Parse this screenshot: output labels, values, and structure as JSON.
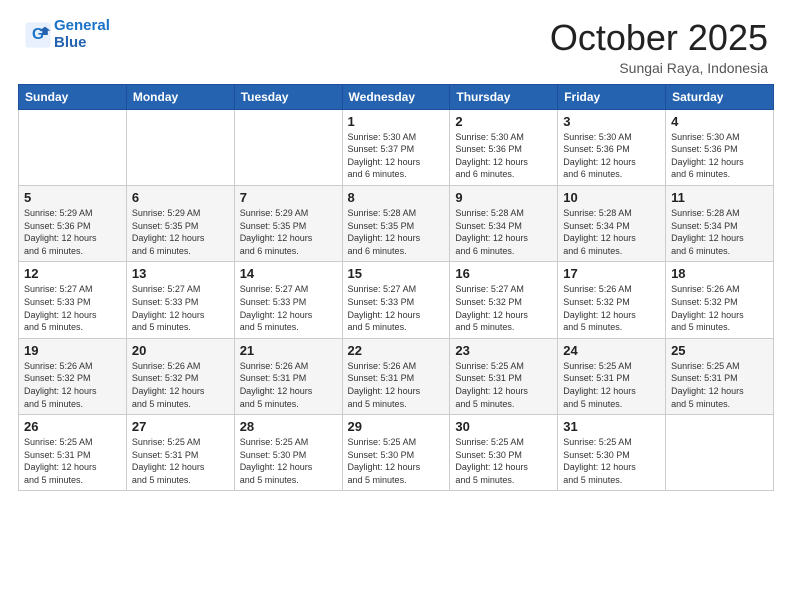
{
  "header": {
    "logo_line1": "General",
    "logo_line2": "Blue",
    "month": "October 2025",
    "location": "Sungai Raya, Indonesia"
  },
  "days_of_week": [
    "Sunday",
    "Monday",
    "Tuesday",
    "Wednesday",
    "Thursday",
    "Friday",
    "Saturday"
  ],
  "weeks": [
    [
      {
        "day": "",
        "detail": ""
      },
      {
        "day": "",
        "detail": ""
      },
      {
        "day": "",
        "detail": ""
      },
      {
        "day": "1",
        "detail": "Sunrise: 5:30 AM\nSunset: 5:37 PM\nDaylight: 12 hours\nand 6 minutes."
      },
      {
        "day": "2",
        "detail": "Sunrise: 5:30 AM\nSunset: 5:36 PM\nDaylight: 12 hours\nand 6 minutes."
      },
      {
        "day": "3",
        "detail": "Sunrise: 5:30 AM\nSunset: 5:36 PM\nDaylight: 12 hours\nand 6 minutes."
      },
      {
        "day": "4",
        "detail": "Sunrise: 5:30 AM\nSunset: 5:36 PM\nDaylight: 12 hours\nand 6 minutes."
      }
    ],
    [
      {
        "day": "5",
        "detail": "Sunrise: 5:29 AM\nSunset: 5:36 PM\nDaylight: 12 hours\nand 6 minutes."
      },
      {
        "day": "6",
        "detail": "Sunrise: 5:29 AM\nSunset: 5:35 PM\nDaylight: 12 hours\nand 6 minutes."
      },
      {
        "day": "7",
        "detail": "Sunrise: 5:29 AM\nSunset: 5:35 PM\nDaylight: 12 hours\nand 6 minutes."
      },
      {
        "day": "8",
        "detail": "Sunrise: 5:28 AM\nSunset: 5:35 PM\nDaylight: 12 hours\nand 6 minutes."
      },
      {
        "day": "9",
        "detail": "Sunrise: 5:28 AM\nSunset: 5:34 PM\nDaylight: 12 hours\nand 6 minutes."
      },
      {
        "day": "10",
        "detail": "Sunrise: 5:28 AM\nSunset: 5:34 PM\nDaylight: 12 hours\nand 6 minutes."
      },
      {
        "day": "11",
        "detail": "Sunrise: 5:28 AM\nSunset: 5:34 PM\nDaylight: 12 hours\nand 6 minutes."
      }
    ],
    [
      {
        "day": "12",
        "detail": "Sunrise: 5:27 AM\nSunset: 5:33 PM\nDaylight: 12 hours\nand 5 minutes."
      },
      {
        "day": "13",
        "detail": "Sunrise: 5:27 AM\nSunset: 5:33 PM\nDaylight: 12 hours\nand 5 minutes."
      },
      {
        "day": "14",
        "detail": "Sunrise: 5:27 AM\nSunset: 5:33 PM\nDaylight: 12 hours\nand 5 minutes."
      },
      {
        "day": "15",
        "detail": "Sunrise: 5:27 AM\nSunset: 5:33 PM\nDaylight: 12 hours\nand 5 minutes."
      },
      {
        "day": "16",
        "detail": "Sunrise: 5:27 AM\nSunset: 5:32 PM\nDaylight: 12 hours\nand 5 minutes."
      },
      {
        "day": "17",
        "detail": "Sunrise: 5:26 AM\nSunset: 5:32 PM\nDaylight: 12 hours\nand 5 minutes."
      },
      {
        "day": "18",
        "detail": "Sunrise: 5:26 AM\nSunset: 5:32 PM\nDaylight: 12 hours\nand 5 minutes."
      }
    ],
    [
      {
        "day": "19",
        "detail": "Sunrise: 5:26 AM\nSunset: 5:32 PM\nDaylight: 12 hours\nand 5 minutes."
      },
      {
        "day": "20",
        "detail": "Sunrise: 5:26 AM\nSunset: 5:32 PM\nDaylight: 12 hours\nand 5 minutes."
      },
      {
        "day": "21",
        "detail": "Sunrise: 5:26 AM\nSunset: 5:31 PM\nDaylight: 12 hours\nand 5 minutes."
      },
      {
        "day": "22",
        "detail": "Sunrise: 5:26 AM\nSunset: 5:31 PM\nDaylight: 12 hours\nand 5 minutes."
      },
      {
        "day": "23",
        "detail": "Sunrise: 5:25 AM\nSunset: 5:31 PM\nDaylight: 12 hours\nand 5 minutes."
      },
      {
        "day": "24",
        "detail": "Sunrise: 5:25 AM\nSunset: 5:31 PM\nDaylight: 12 hours\nand 5 minutes."
      },
      {
        "day": "25",
        "detail": "Sunrise: 5:25 AM\nSunset: 5:31 PM\nDaylight: 12 hours\nand 5 minutes."
      }
    ],
    [
      {
        "day": "26",
        "detail": "Sunrise: 5:25 AM\nSunset: 5:31 PM\nDaylight: 12 hours\nand 5 minutes."
      },
      {
        "day": "27",
        "detail": "Sunrise: 5:25 AM\nSunset: 5:31 PM\nDaylight: 12 hours\nand 5 minutes."
      },
      {
        "day": "28",
        "detail": "Sunrise: 5:25 AM\nSunset: 5:30 PM\nDaylight: 12 hours\nand 5 minutes."
      },
      {
        "day": "29",
        "detail": "Sunrise: 5:25 AM\nSunset: 5:30 PM\nDaylight: 12 hours\nand 5 minutes."
      },
      {
        "day": "30",
        "detail": "Sunrise: 5:25 AM\nSunset: 5:30 PM\nDaylight: 12 hours\nand 5 minutes."
      },
      {
        "day": "31",
        "detail": "Sunrise: 5:25 AM\nSunset: 5:30 PM\nDaylight: 12 hours\nand 5 minutes."
      },
      {
        "day": "",
        "detail": ""
      }
    ]
  ]
}
